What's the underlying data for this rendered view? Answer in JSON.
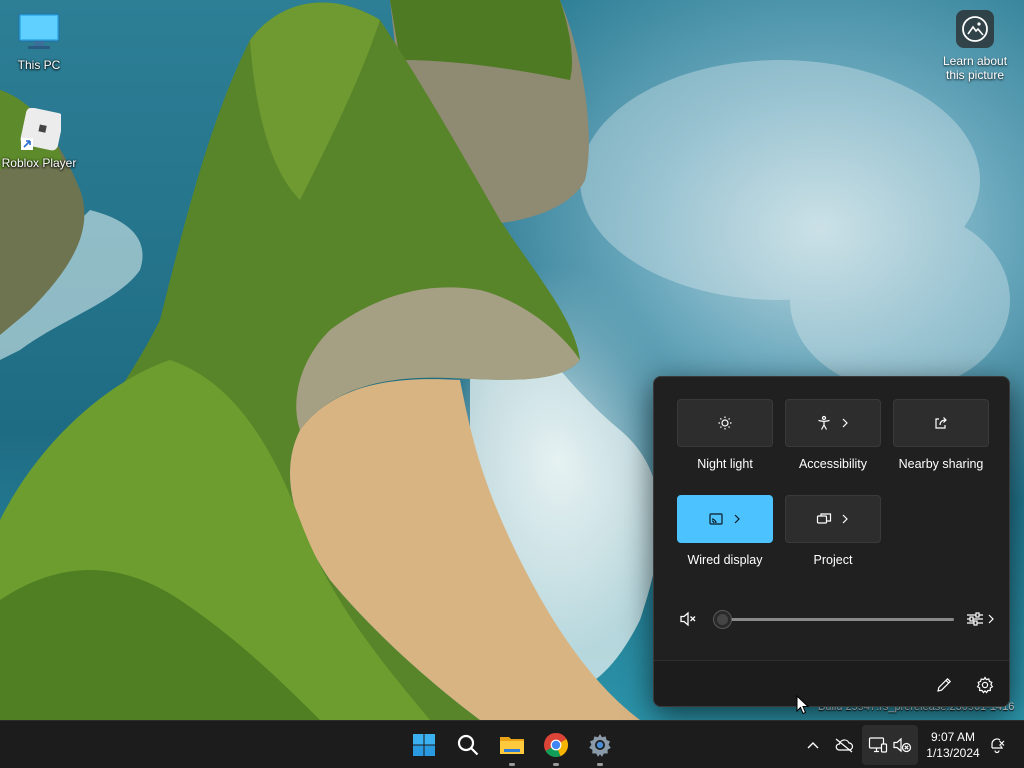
{
  "desktop": {
    "icons": [
      {
        "label": "This PC",
        "icon": "this-pc-icon"
      },
      {
        "label": "Roblox Player",
        "icon": "roblox-icon"
      }
    ],
    "learn_picture": {
      "label": "Learn about this picture",
      "icon": "camera-circle-icon"
    },
    "watermark": "Build 25947.rs_prerelease.230901-1416"
  },
  "quick_settings": {
    "tiles": [
      {
        "label": "Night light",
        "icon": "brightness-icon",
        "active": false,
        "has_chevron": false
      },
      {
        "label": "Accessibility",
        "icon": "accessibility-icon",
        "active": false,
        "has_chevron": true
      },
      {
        "label": "Nearby sharing",
        "icon": "share-icon",
        "active": false,
        "has_chevron": false
      },
      {
        "label": "Wired display",
        "icon": "cast-icon",
        "active": true,
        "has_chevron": true
      },
      {
        "label": "Project",
        "icon": "project-icon",
        "active": false,
        "has_chevron": true
      }
    ],
    "volume": {
      "level": 0,
      "muted": true
    },
    "colors": {
      "panel": "#202020",
      "tile": "#2d2d2d",
      "accent": "#4cc2ff"
    }
  },
  "taskbar": {
    "apps": [
      "start-icon",
      "search-icon",
      "file-explorer-icon",
      "chrome-icon",
      "settings-icon"
    ],
    "clock": {
      "time": "9:07 AM",
      "date": "1/13/2024"
    }
  }
}
